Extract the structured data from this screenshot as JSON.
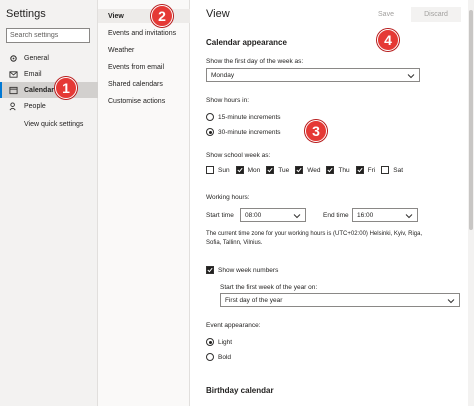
{
  "settings": {
    "title": "Settings",
    "search_placeholder": "Search settings",
    "nav": [
      {
        "label": "General",
        "icon": "gear-icon"
      },
      {
        "label": "Email",
        "icon": "mail-icon"
      },
      {
        "label": "Calendar",
        "icon": "calendar-icon"
      },
      {
        "label": "People",
        "icon": "people-icon"
      }
    ],
    "quick_settings": "View quick settings"
  },
  "submenu": [
    "View",
    "Events and invitations",
    "Weather",
    "Events from email",
    "Shared calendars",
    "Customise actions"
  ],
  "main": {
    "title": "View",
    "save": "Save",
    "discard": "Discard",
    "calendar_appearance": "Calendar appearance",
    "first_day_label": "Show the first day of the week as:",
    "first_day_value": "Monday",
    "hours_label": "Show hours in:",
    "hours_options": [
      "15-minute increments",
      "30-minute increments"
    ],
    "hours_selected": 1,
    "school_week_label": "Show school week as:",
    "days": [
      {
        "label": "Sun",
        "checked": false
      },
      {
        "label": "Mon",
        "checked": true
      },
      {
        "label": "Tue",
        "checked": true
      },
      {
        "label": "Wed",
        "checked": true
      },
      {
        "label": "Thu",
        "checked": true
      },
      {
        "label": "Fri",
        "checked": true
      },
      {
        "label": "Sat",
        "checked": false
      }
    ],
    "working_hours_label": "Working hours:",
    "start_time_label": "Start time",
    "start_time_value": "08:00",
    "end_time_label": "End time",
    "end_time_value": "16:00",
    "timezone_note": "The current time zone for your working hours is (UTC+02:00) Helsinki, Kyiv, Riga, Sofia, Tallinn, Vilnius.",
    "week_numbers_label": "Show week numbers",
    "first_week_label": "Start the first week of the year on:",
    "first_week_value": "First day of the year",
    "event_appearance_label": "Event appearance:",
    "event_options": [
      "Light",
      "Bold"
    ],
    "event_selected": 0,
    "birthday_calendar": "Birthday calendar"
  },
  "badges": [
    "1",
    "2",
    "3",
    "4"
  ],
  "colors": {
    "badge": "#e53935",
    "active_bar": "#0078d4"
  }
}
